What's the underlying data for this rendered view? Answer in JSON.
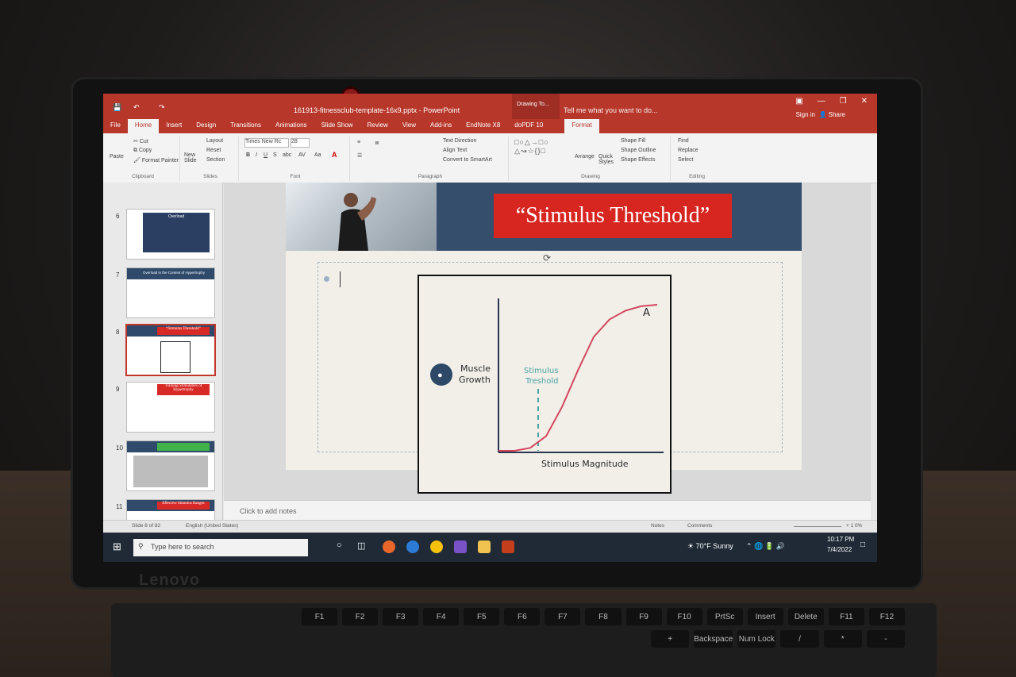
{
  "window": {
    "title": "161913-fitnessclub-template-16x9.pptx - PowerPoint",
    "contextual_tab_group": "Drawing To...",
    "tell_me": "Tell me what you want to do...",
    "sign_in": "Sign in",
    "share": "Share"
  },
  "tabs": [
    "File",
    "Home",
    "Insert",
    "Design",
    "Transitions",
    "Animations",
    "Slide Show",
    "Review",
    "View",
    "Add-ins",
    "EndNote X8",
    "doPDF 10"
  ],
  "format_tab": "Format",
  "ribbon": {
    "clipboard": {
      "paste": "Paste",
      "cut": "Cut",
      "copy": "Copy",
      "format_painter": "Format Painter",
      "label": "Clipboard"
    },
    "slides": {
      "new_slide": "New Slide",
      "layout": "Layout",
      "reset": "Reset",
      "section": "Section",
      "label": "Slides"
    },
    "font": {
      "font_name": "Times New Rc",
      "font_size": "28",
      "label": "Font",
      "bold": "B",
      "italic": "I",
      "underline": "U",
      "strike": "S",
      "shadow": "abc",
      "spacing": "AV",
      "case": "Aa"
    },
    "paragraph": {
      "text_direction": "Text Direction",
      "align_text": "Align Text",
      "convert_smartart": "Convert to SmartArt",
      "label": "Paragraph"
    },
    "drawing": {
      "arrange": "Arrange",
      "quick_styles": "Quick Styles",
      "shape_fill": "Shape Fill",
      "shape_outline": "Shape Outline",
      "shape_effects": "Shape Effects",
      "label": "Drawing"
    },
    "editing": {
      "find": "Find",
      "replace": "Replace",
      "select": "Select",
      "label": "Editing"
    }
  },
  "thumbnails": [
    {
      "num": "6",
      "title": "Overload"
    },
    {
      "num": "7",
      "title": "Overload in the Context of Hypertrophy"
    },
    {
      "num": "8",
      "title": "“Stimulus Threshold”",
      "selected": true
    },
    {
      "num": "9",
      "title": "Training Stimulators of Hypertrophy"
    },
    {
      "num": "10",
      "title": ""
    },
    {
      "num": "11",
      "title": "Effective Stimulus Ranges"
    }
  ],
  "slide": {
    "title": "“Stimulus Threshold”",
    "chart": {
      "y_label_line1": "Muscle",
      "y_label_line2": "Growth",
      "threshold_line1": "Stimulus",
      "threshold_line2": "Treshold",
      "point_label": "A",
      "x_label": "Stimulus Magnitude"
    }
  },
  "chart_data": {
    "type": "line",
    "title": "",
    "xlabel": "Stimulus Magnitude",
    "ylabel": "Muscle Growth",
    "x": [
      0,
      1,
      2,
      3,
      4,
      5,
      6,
      7,
      8,
      9,
      10
    ],
    "series": [
      {
        "values": [
          0,
          0,
          0.02,
          0.1,
          0.3,
          0.55,
          0.78,
          0.9,
          0.96,
          0.99,
          1.0
        ]
      }
    ],
    "annotations": [
      {
        "text": "Stimulus Treshold",
        "x": 2.5
      },
      {
        "text": "A",
        "x": 9
      }
    ],
    "colors": {
      "curve": "#d4465f",
      "threshold": "#4aa3a3"
    }
  },
  "notes": "Click to add notes",
  "status": {
    "slide_of": "Slide 8 of 82",
    "language": "English (United States)",
    "notes_btn": "Notes",
    "comments_btn": "Comments",
    "zoom": "+ 1 0%"
  },
  "taskbar": {
    "search_placeholder": "Type here to search",
    "weather": "70°F Sunny",
    "time": "10:17 PM",
    "date": "7/4/2022"
  },
  "laptop": {
    "brand": "Lenovo"
  },
  "keys_row1": [
    "F1",
    "F2",
    "F3",
    "F4",
    "F5",
    "F6",
    "F7",
    "F8",
    "F9",
    "F10",
    "PrtSc",
    "Insert",
    "Delete",
    "F11",
    "F12"
  ],
  "keys_row2": [
    "+",
    "Backspace",
    "Num Lock",
    "/",
    "*",
    "-"
  ]
}
